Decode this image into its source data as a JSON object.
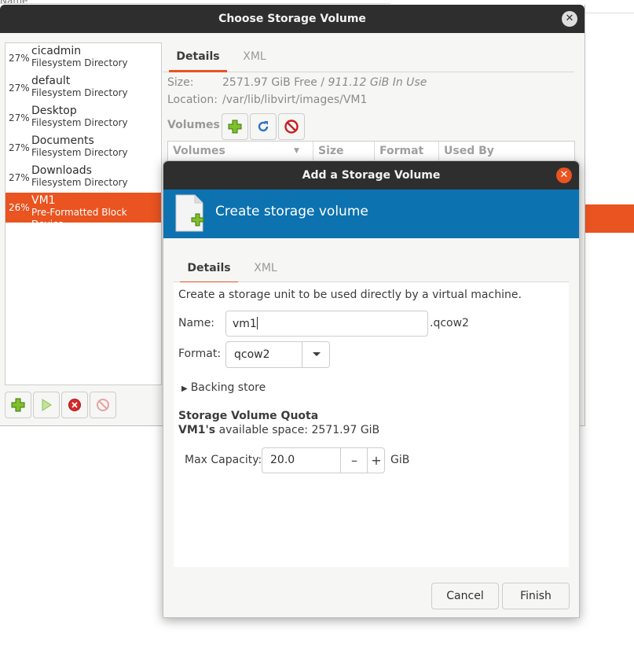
{
  "background": {
    "cutoff_header": "Name"
  },
  "choose_window": {
    "title": "Choose Storage Volume",
    "pools": [
      {
        "percent": "27%",
        "name": "cicadmin",
        "type": "Filesystem Directory"
      },
      {
        "percent": "27%",
        "name": "default",
        "type": "Filesystem Directory"
      },
      {
        "percent": "27%",
        "name": "Desktop",
        "type": "Filesystem Directory"
      },
      {
        "percent": "27%",
        "name": "Documents",
        "type": "Filesystem Directory"
      },
      {
        "percent": "27%",
        "name": "Downloads",
        "type": "Filesystem Directory"
      },
      {
        "percent": "26%",
        "name": "VM1",
        "type": "Pre-Formatted Block Device",
        "selected": true
      }
    ],
    "tabs": [
      "Details",
      "XML"
    ],
    "size_label": "Size:",
    "size_free": "2571.97 GiB Free /",
    "size_in_use": "911.12 GiB In Use",
    "location_label": "Location:",
    "location_value": "/var/lib/libvirt/images/VM1",
    "volumes_label": "Volumes",
    "volume_columns": [
      "Volumes",
      "Size",
      "Format",
      "Used By"
    ]
  },
  "add_dialog": {
    "title": "Add a Storage Volume",
    "banner_title": "Create storage volume",
    "tabs": [
      "Details",
      "XML"
    ],
    "description": "Create a storage unit to be used directly by a virtual machine.",
    "name_label": "Name:",
    "name_value": "vm1",
    "name_suffix": ".qcow2",
    "format_label": "Format:",
    "format_value": "qcow2",
    "backing_store_label": "Backing store",
    "quota_title": "Storage Volume Quota",
    "quota_pool": "VM1's",
    "quota_text": "available space: 2571.97 GiB",
    "max_capacity_label": "Max Capacity:",
    "max_capacity_value": "20.0",
    "capacity_unit": "GiB",
    "cancel_label": "Cancel",
    "finish_label": "Finish"
  },
  "colors": {
    "accent_orange": "#e95420",
    "banner_blue": "#0d72b0",
    "titlebar": "#2e2e2e"
  }
}
